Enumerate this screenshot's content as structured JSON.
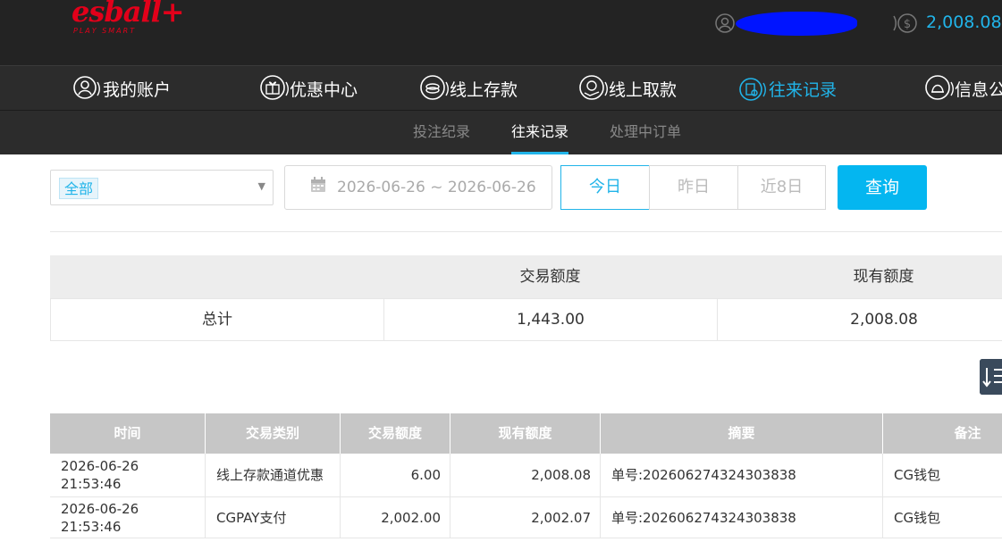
{
  "header": {
    "logo_text": "esball+",
    "logo_tagline": "PLAY SMART",
    "balance": "2,008.08"
  },
  "mainnav": {
    "items": [
      {
        "label": "我的账户",
        "icon": "user-icon"
      },
      {
        "label": "优惠中心",
        "icon": "gift-icon"
      },
      {
        "label": "线上存款",
        "icon": "deposit-icon"
      },
      {
        "label": "线上取款",
        "icon": "withdraw-icon"
      },
      {
        "label": "往来记录",
        "icon": "records-icon"
      },
      {
        "label": "信息公",
        "icon": "bell-icon"
      }
    ],
    "active_index": 4
  },
  "subnav": {
    "items": [
      "投注纪录",
      "往来记录",
      "处理中订单"
    ],
    "active_index": 1
  },
  "filters": {
    "type_selected": "全部",
    "date_range": "2026-06-26 ~ 2026-06-26",
    "quick": [
      "今日",
      "昨日",
      "近8日"
    ],
    "quick_active": 0,
    "search_label": "查询"
  },
  "summary": {
    "headers": [
      "",
      "交易额度",
      "现有额度"
    ],
    "row": [
      "总计",
      "1,443.00",
      "2,008.08"
    ]
  },
  "records": {
    "headers": [
      "时间",
      "交易类别",
      "交易额度",
      "现有额度",
      "摘要",
      "备注"
    ],
    "rows": [
      [
        "2026-06-26 21:53:46",
        "线上存款通道优惠",
        "6.00",
        "2,008.08",
        "单号:202606274324303838",
        "CG钱包"
      ],
      [
        "2026-06-26 21:53:46",
        "CGPAY支付",
        "2,002.00",
        "2,002.07",
        "单号:202606274324303838",
        "CG钱包"
      ]
    ]
  },
  "colors": {
    "accent": "#21b4e9",
    "topbar": "#232323",
    "nav": "#2c2c2c",
    "brand": "#e2001a"
  }
}
